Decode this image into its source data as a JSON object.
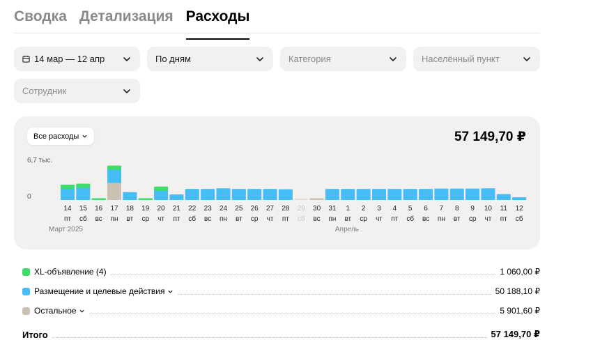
{
  "tabs": [
    {
      "label": "Сводка",
      "active": false
    },
    {
      "label": "Детализация",
      "active": false
    },
    {
      "label": "Расходы",
      "active": true
    }
  ],
  "filters": {
    "period": "14 мар — 12 апр",
    "grouping": "По дням",
    "category_placeholder": "Категория",
    "locality_placeholder": "Населённый пункт",
    "employee_placeholder": "Сотрудник"
  },
  "chart_card": {
    "expense_selector": "Все расходы",
    "total": "57 149,70 ₽",
    "ymax_label": "6,7 тыс.",
    "ymin_label": "0",
    "month_march": "Март 2025",
    "month_april": "Апрель"
  },
  "chart_data": {
    "type": "bar",
    "stacked": true,
    "ymax": 6700,
    "colors": {
      "xl": "#3ddc69",
      "placement": "#46bdf5",
      "other": "#cbc1b3"
    },
    "days": [
      "14",
      "15",
      "16",
      "17",
      "18",
      "19",
      "20",
      "21",
      "22",
      "23",
      "24",
      "25",
      "26",
      "27",
      "28",
      "29",
      "30",
      "31",
      "1",
      "2",
      "3",
      "4",
      "5",
      "6",
      "7",
      "8",
      "9",
      "10",
      "11",
      "12"
    ],
    "weekdays": [
      "пт",
      "сб",
      "вс",
      "пн",
      "вт",
      "ср",
      "чт",
      "пт",
      "сб",
      "вс",
      "пн",
      "вт",
      "ср",
      "чт",
      "пт",
      "сб",
      "вс",
      "пн",
      "вт",
      "ср",
      "чт",
      "пт",
      "сб",
      "вс",
      "пн",
      "вт",
      "ср",
      "чт",
      "пт",
      "сб"
    ],
    "disabled": [
      "29"
    ],
    "series": [
      {
        "name": "XL-объявление (4)",
        "key": "xl",
        "values": [
          130,
          130,
          200,
          200,
          0,
          200,
          200,
          0,
          0,
          0,
          0,
          0,
          0,
          0,
          0,
          0,
          0,
          0,
          0,
          0,
          0,
          0,
          0,
          0,
          0,
          0,
          0,
          0,
          0,
          0
        ]
      },
      {
        "name": "Размещение и целевые действия",
        "key": "placement",
        "values": [
          2100,
          2250,
          0,
          2400,
          1200,
          0,
          1800,
          850,
          1700,
          1700,
          1800,
          1700,
          1700,
          1700,
          1650,
          0,
          0,
          1700,
          1700,
          1700,
          1700,
          1700,
          1700,
          1700,
          1750,
          1750,
          1750,
          1800,
          900,
          400
        ]
      },
      {
        "name": "Остальное",
        "key": "other",
        "values": [
          0,
          0,
          0,
          2650,
          0,
          0,
          0,
          0,
          0,
          0,
          0,
          0,
          0,
          0,
          0,
          0,
          180,
          0,
          0,
          0,
          0,
          0,
          0,
          0,
          0,
          0,
          0,
          0,
          0,
          0
        ]
      }
    ]
  },
  "legend": [
    {
      "label": "XL-объявление (4)",
      "amount": "1 060,00 ₽",
      "color": "#3ddc69",
      "expandable": false
    },
    {
      "label": "Размещение и целевые действия",
      "amount": "50 188,10 ₽",
      "color": "#46bdf5",
      "expandable": true
    },
    {
      "label": "Остальное",
      "amount": "5 901,60 ₽",
      "color": "#cbc1b3",
      "expandable": true
    }
  ],
  "total": {
    "label": "Итого",
    "amount": "57 149,70 ₽"
  }
}
